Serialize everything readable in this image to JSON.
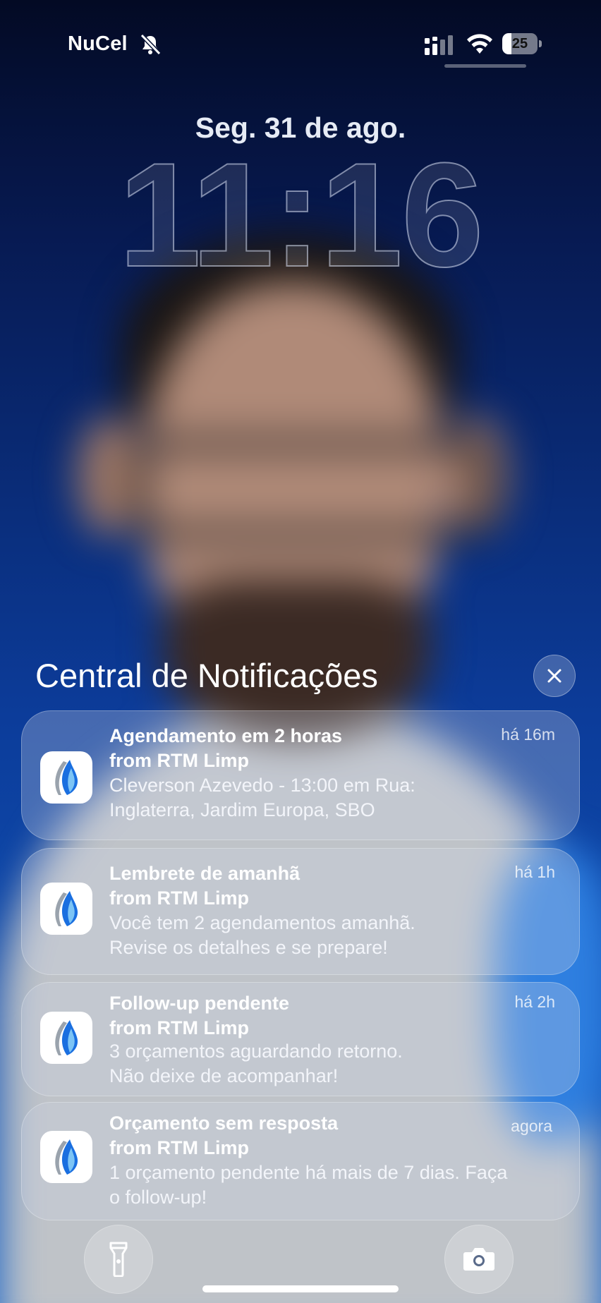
{
  "status_bar": {
    "carrier": "NuCel",
    "battery_level": "25",
    "battery_fraction": 0.25,
    "icons": [
      "bell-slash-icon",
      "cellular-signal-icon",
      "wifi-icon",
      "battery-icon"
    ]
  },
  "lock_screen": {
    "date": "Seg. 31 de ago.",
    "time": "11:16"
  },
  "notification_center": {
    "title": "Central de Notificações",
    "close_icon": "close-icon",
    "app_icon": "rtm-limp-app-icon",
    "notifications": [
      {
        "title_line1": "Agendamento em 2 horas",
        "title_line2": "from RTM Limp",
        "body_line1": "Cleverson Azevedo - 13:00 em Rua:",
        "body_line2": "Inglaterra, Jardim Europa, SBO",
        "time": "há 16m"
      },
      {
        "title_line1": "Lembrete de amanhã",
        "title_line2": "from RTM Limp",
        "body_line1": "Você tem 2 agendamentos amanhã.",
        "body_line2": "Revise os detalhes e se prepare!",
        "time": "há 1h"
      },
      {
        "title_line1": "Follow-up pendente",
        "title_line2": "from RTM Limp",
        "body_line1": "3 orçamentos aguardando retorno.",
        "body_line2": "Não deixe de acompanhar!",
        "time": "há 2h"
      },
      {
        "title_line1": "Orçamento sem resposta",
        "title_line2": "from RTM Limp",
        "body_line1": "1 orçamento pendente há mais de 7 dias. Faça",
        "body_line2": "o follow-up!",
        "time": "agora"
      }
    ]
  },
  "quick_actions": {
    "left_icon": "flashlight-icon",
    "right_icon": "camera-icon"
  },
  "colors": {
    "app_icon_blue": "#1a6fe0",
    "app_icon_gray": "#9aa3ad"
  }
}
